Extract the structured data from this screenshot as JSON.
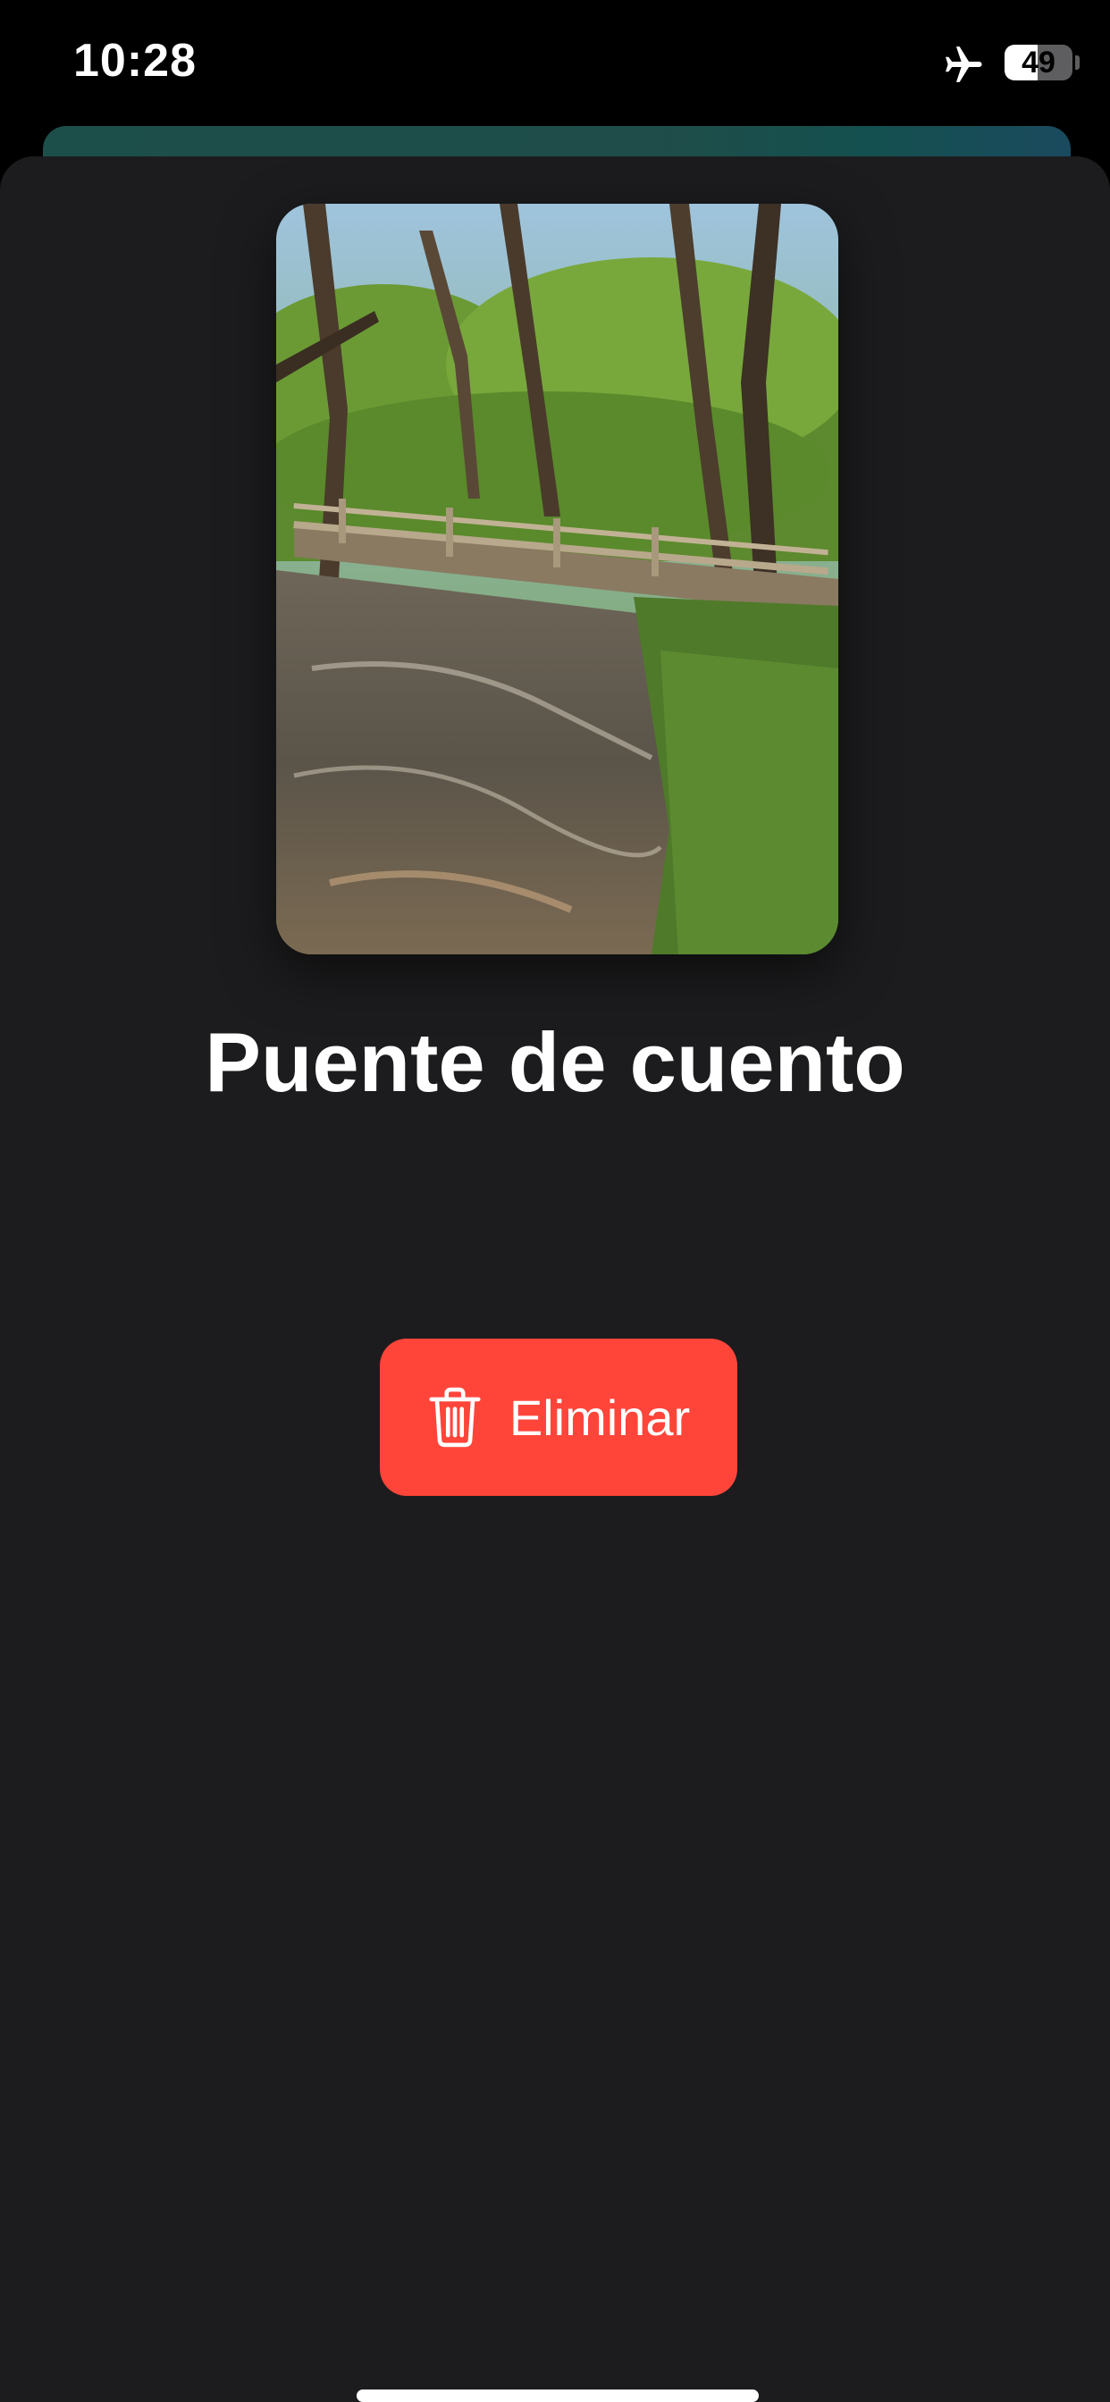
{
  "status_bar": {
    "time": "10:28",
    "battery_level": "49",
    "battery_fraction": 0.49,
    "airplane_mode_icon": "airplane-icon"
  },
  "detail": {
    "photo_icon": "photo-thumbnail",
    "title": "Puente de cuento",
    "delete_label": "Eliminar",
    "delete_icon": "trash-icon"
  },
  "colors": {
    "sheet_background": "#1c1c1e",
    "delete_button": "#ff453a",
    "text": "#ffffff"
  }
}
